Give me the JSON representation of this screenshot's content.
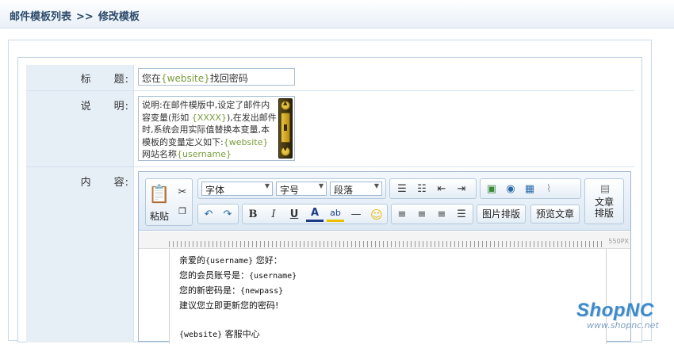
{
  "breadcrumb": {
    "list": "邮件模板列表",
    "separator": ">>",
    "current": "修改模板"
  },
  "form": {
    "title_label": "标　　题:",
    "title_value_prefix": "您在",
    "title_value_var": "{website}",
    "title_value_suffix": "找回密码",
    "desc_label": "说　　明:",
    "desc_text_1": "说明:在邮件模版中,设定了邮件内容变量(形如 ",
    "desc_var_1": "{XXXX}",
    "desc_text_2": "),在发出邮件时,系统会用实际值替换本变量,本模板的变量定义如下:",
    "desc_var_2": "{website}",
    "desc_text_3": " 网站名称",
    "desc_var_3": "{username}",
    "content_label": "内　　容:"
  },
  "toolbar": {
    "paste": "粘贴",
    "font": "字体",
    "size": "字号",
    "paragraph": "段落",
    "image_layout": "图片排版",
    "preview": "预览文章",
    "article_layout_1": "文章",
    "article_layout_2": "排版",
    "bold": "B",
    "italic": "I",
    "underline": "U",
    "font_color": "A",
    "ruler_label": "550PX"
  },
  "content": {
    "line1_prefix": "亲爱的",
    "line1_var": "{username}",
    "line1_suffix": " 您好：",
    "line2_prefix": "您的会员账号是：",
    "line2_var": "{username}",
    "line3_prefix": "您的新密码是：",
    "line3_var": "{newpass}",
    "line4": "建议您立即更新您的密码!",
    "line5_var": "{website}",
    "line5_suffix": " 客服中心"
  },
  "brand": {
    "logo": "ShopNC",
    "url": "www.shopnc.net"
  }
}
